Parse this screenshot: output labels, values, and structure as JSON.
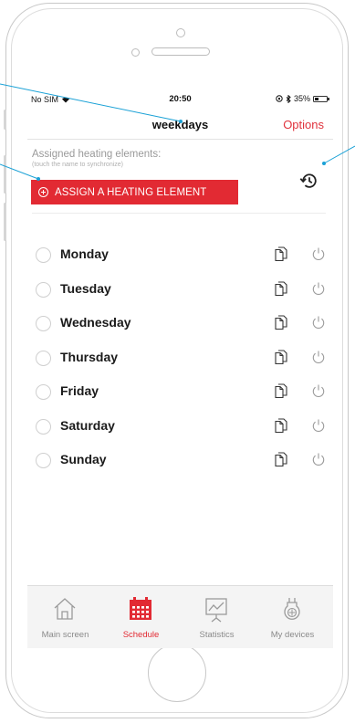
{
  "status_bar": {
    "carrier": "No SIM",
    "time": "20:50",
    "battery": "35%",
    "battery_level": 0.35
  },
  "nav": {
    "title": "weekdays",
    "options_label": "Options"
  },
  "assigned": {
    "label": "Assigned heating elements:",
    "hint": "(touch the name to synchronize)",
    "assign_button": "ASSIGN A HEATING ELEMENT"
  },
  "days": [
    {
      "label": "Monday"
    },
    {
      "label": "Tuesday"
    },
    {
      "label": "Wednesday"
    },
    {
      "label": "Thursday"
    },
    {
      "label": "Friday"
    },
    {
      "label": "Saturday"
    },
    {
      "label": "Sunday"
    }
  ],
  "tabbar": {
    "tabs": [
      {
        "label": "Main screen",
        "icon": "home-icon",
        "active": false
      },
      {
        "label": "Schedule",
        "icon": "calendar-icon",
        "active": true
      },
      {
        "label": "Statistics",
        "icon": "chart-board-icon",
        "active": false
      },
      {
        "label": "My devices",
        "icon": "plug-icon",
        "active": false
      }
    ]
  },
  "colors": {
    "accent": "#e22a33",
    "callout": "#1aa1d6"
  }
}
